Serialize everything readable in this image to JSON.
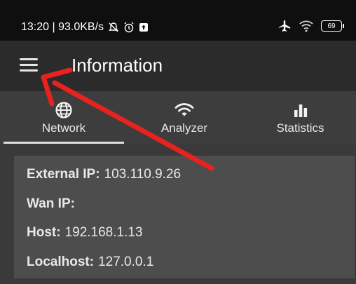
{
  "status_bar": {
    "time_speed": "13:20 | 93.0KB/s",
    "battery": "69",
    "icons": [
      "bell-off-icon",
      "alarm-icon",
      "notification-icon",
      "airplane-icon",
      "wifi-icon",
      "battery-icon"
    ]
  },
  "app_bar": {
    "title": "Information",
    "menu_icon": "hamburger-menu-icon"
  },
  "tabs": [
    {
      "label": "Network",
      "icon": "globe-icon",
      "selected": true
    },
    {
      "label": "Analyzer",
      "icon": "wifi-icon",
      "selected": false
    },
    {
      "label": "Statistics",
      "icon": "bar-chart-icon",
      "selected": false
    }
  ],
  "info": [
    {
      "key": "External IP:",
      "value": "103.110.9.26"
    },
    {
      "key": "Wan IP:",
      "value": ""
    },
    {
      "key": "Host:",
      "value": "192.168.1.13"
    },
    {
      "key": "Localhost:",
      "value": "127.0.0.1"
    }
  ],
  "annotation": {
    "color": "#e8231f"
  }
}
